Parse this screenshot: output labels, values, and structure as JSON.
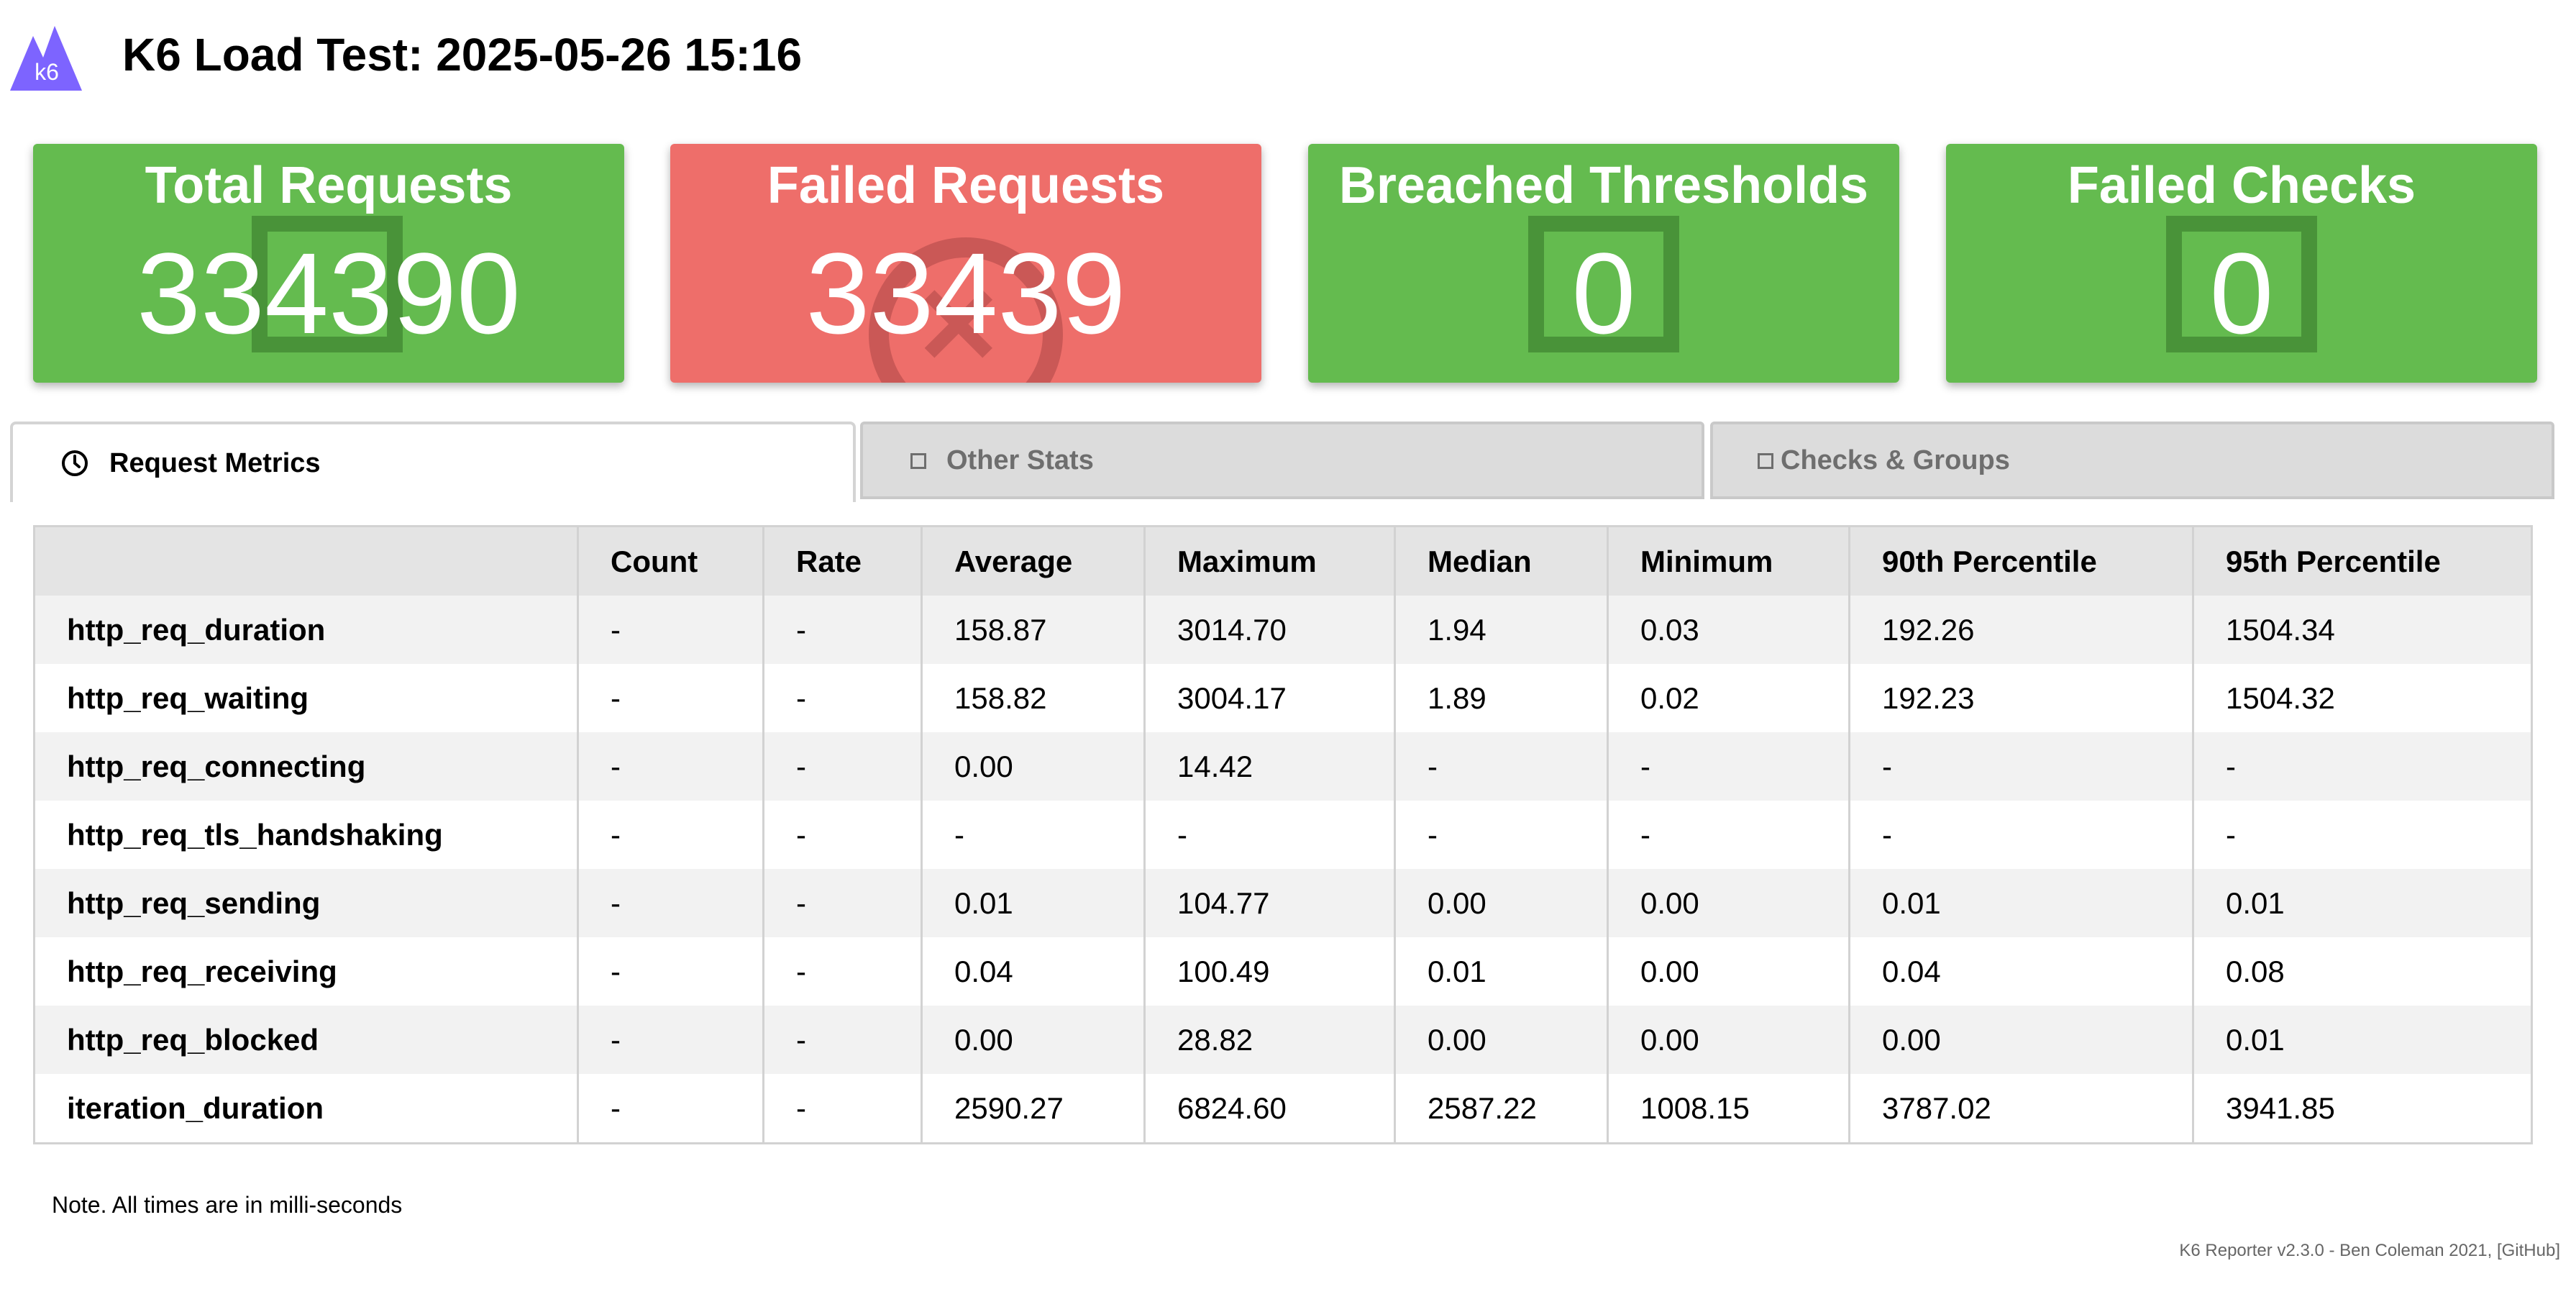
{
  "app": {
    "title": "K6 Load Test: 2025-05-26 15:16",
    "logo_text": "k6",
    "logo_color": "#7d64ff"
  },
  "cards": [
    {
      "key": "total",
      "title": "Total Requests",
      "value": "334390",
      "color": "#64bb4f",
      "icon": "square-icon"
    },
    {
      "key": "failed",
      "title": "Failed Requests",
      "value": "33439",
      "color": "#ee6e6a",
      "icon": "times-circle-icon"
    },
    {
      "key": "thresholds",
      "title": "Breached Thresholds",
      "value": "0",
      "color": "#64bb4f",
      "icon": "square-icon"
    },
    {
      "key": "checks",
      "title": "Failed Checks",
      "value": "0",
      "color": "#64bb4f",
      "icon": "square-icon"
    }
  ],
  "tabs": [
    {
      "label": "Request Metrics",
      "icon": "clock-icon",
      "active": true
    },
    {
      "label": "Other Stats",
      "icon": "square-icon",
      "active": false
    },
    {
      "label": "Checks & Groups",
      "icon": "square-icon",
      "active": false
    }
  ],
  "table": {
    "headers": [
      "",
      "Count",
      "Rate",
      "Average",
      "Maximum",
      "Median",
      "Minimum",
      "90th Percentile",
      "95th Percentile"
    ],
    "rows": [
      [
        "http_req_duration",
        "-",
        "-",
        "158.87",
        "3014.70",
        "1.94",
        "0.03",
        "192.26",
        "1504.34"
      ],
      [
        "http_req_waiting",
        "-",
        "-",
        "158.82",
        "3004.17",
        "1.89",
        "0.02",
        "192.23",
        "1504.32"
      ],
      [
        "http_req_connecting",
        "-",
        "-",
        "0.00",
        "14.42",
        "-",
        "-",
        "-",
        "-"
      ],
      [
        "http_req_tls_handshaking",
        "-",
        "-",
        "-",
        "-",
        "-",
        "-",
        "-",
        "-"
      ],
      [
        "http_req_sending",
        "-",
        "-",
        "0.01",
        "104.77",
        "0.00",
        "0.00",
        "0.01",
        "0.01"
      ],
      [
        "http_req_receiving",
        "-",
        "-",
        "0.04",
        "100.49",
        "0.01",
        "0.00",
        "0.04",
        "0.08"
      ],
      [
        "http_req_blocked",
        "-",
        "-",
        "0.00",
        "28.82",
        "0.00",
        "0.00",
        "0.00",
        "0.01"
      ],
      [
        "iteration_duration",
        "-",
        "-",
        "2590.27",
        "6824.60",
        "2587.22",
        "1008.15",
        "3787.02",
        "3941.85"
      ]
    ]
  },
  "note": "Note. All times are in milli-seconds",
  "footer": {
    "text": "K6 Reporter v2.3.0 - Ben Coleman 2021, ",
    "link": "[GitHub]"
  }
}
